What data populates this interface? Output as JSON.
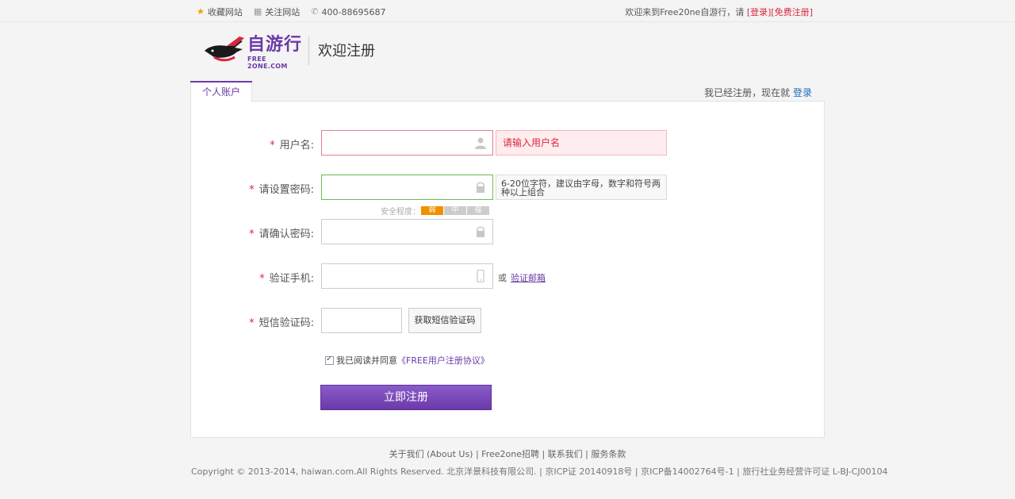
{
  "topbar": {
    "bookmark_label": "收藏网站",
    "follow_label": "关注网站",
    "phone": "400-88695687",
    "welcome_text": "欢迎来到Free20ne自游行，请 ",
    "login_link": "[登录]",
    "register_link": "[免费注册]"
  },
  "header": {
    "logo_text": "自游行",
    "logo_sub": "FREE 2ONE.COM",
    "page_title": "欢迎注册"
  },
  "tabs": {
    "personal": "个人账户",
    "already_text": "我已经注册，现在就 ",
    "login_link": "登录"
  },
  "form": {
    "required_mark": "*",
    "username": {
      "label": "用户名:",
      "value": "",
      "error": "请输入用户名"
    },
    "password": {
      "label": "请设置密码:",
      "value": "",
      "hint": "6-20位字符，建议由字母，数字和符号两种以上组合"
    },
    "strength": {
      "label": "安全程度：",
      "levels": [
        "弱",
        "中",
        "强"
      ]
    },
    "confirm": {
      "label": "请确认密码:",
      "value": ""
    },
    "phone": {
      "label": "验证手机:",
      "value": "",
      "or_text": "或",
      "email_link": "验证邮箱"
    },
    "sms": {
      "label": "短信验证码:",
      "value": "",
      "button": "获取短信验证码"
    },
    "agree": {
      "checked": true,
      "text": "我已阅读并同意",
      "link": "《FREE用户注册协议》"
    },
    "submit": "立即注册"
  },
  "footer": {
    "links": "关于我们 (About Us)  | Free2one招聘 | 联系我们 | 服务条款",
    "copyright": "Copyright © 2013-2014, haiwan.com.All Rights Reserved. 北京洋景科技有限公司. | 京ICP证 20140918号 | 京ICP备14002764号-1 | 旅行社业务经营许可证 L-BJ-CJ00104"
  },
  "colors": {
    "accent": "#6a3aa8",
    "error": "#d9263d",
    "ok": "#6cbb52",
    "weak": "#f28f00"
  }
}
